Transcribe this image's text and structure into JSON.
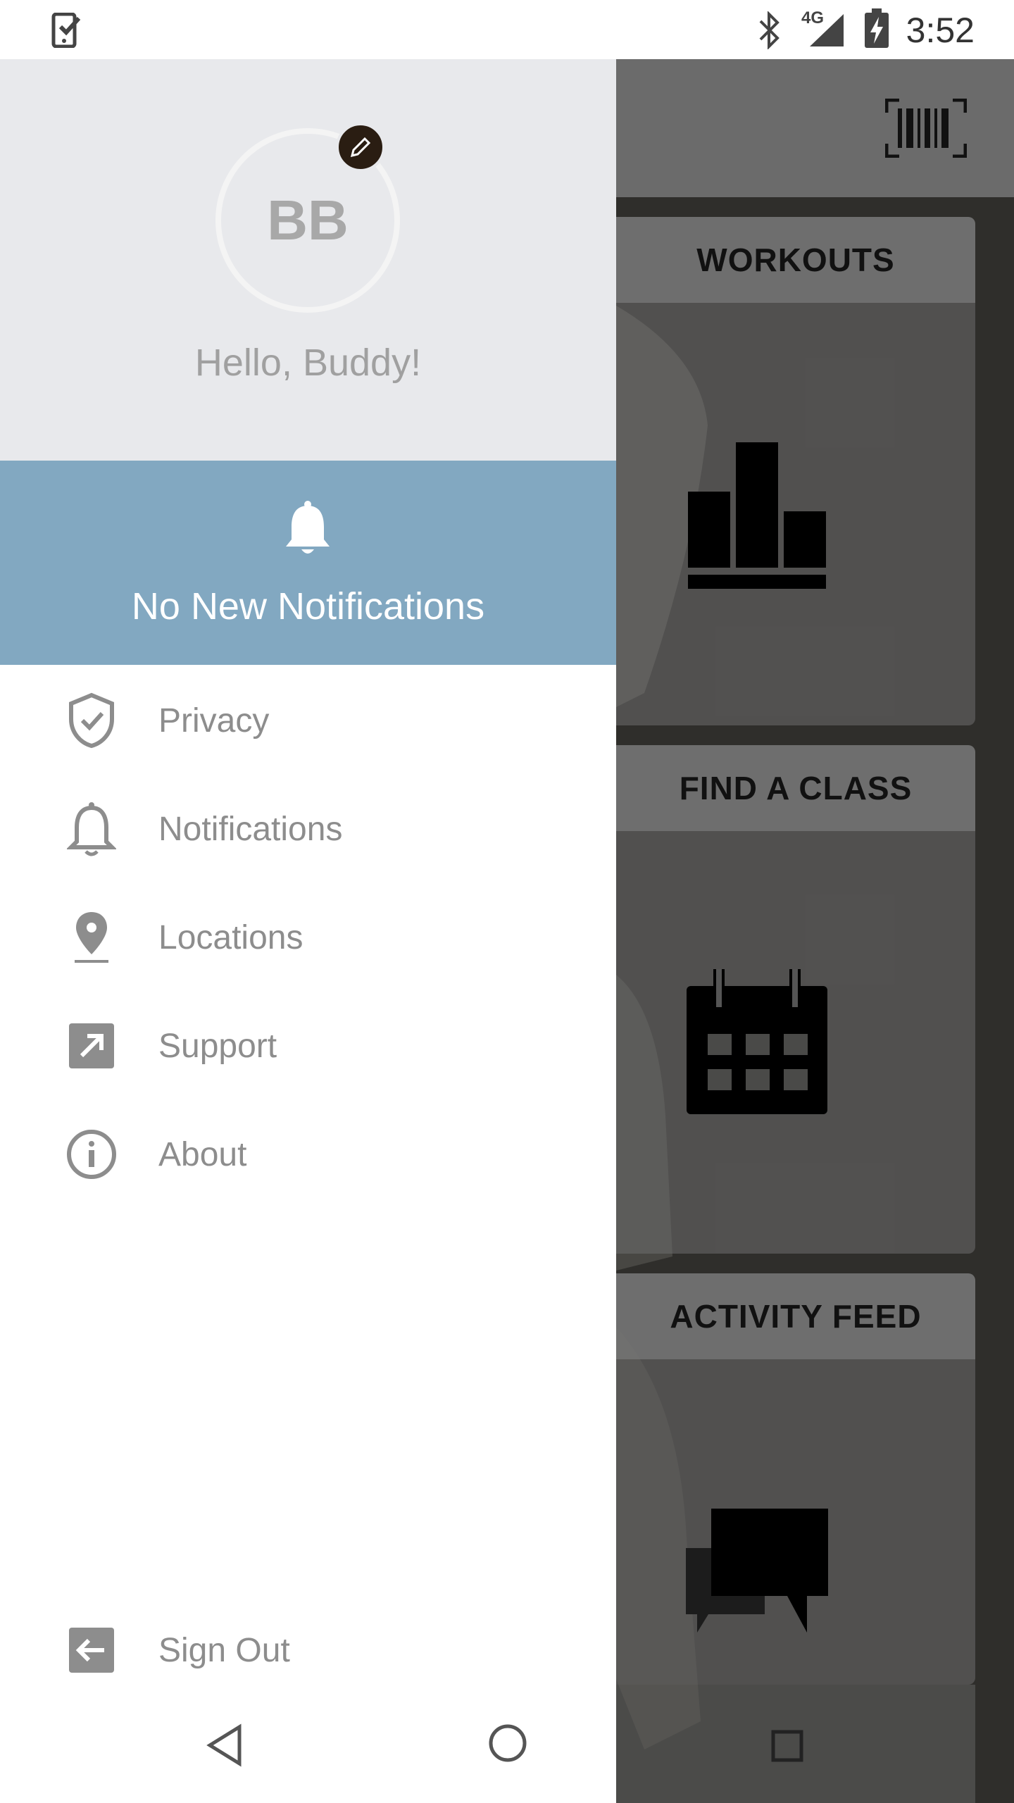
{
  "status_bar": {
    "time": "3:52",
    "network": "4G",
    "icons": [
      "task-checkbox-icon",
      "bluetooth-icon",
      "signal-icon",
      "battery-charging-icon"
    ]
  },
  "drawer": {
    "avatar_initials": "BB",
    "greeting": "Hello, Buddy!",
    "notifications_banner": "No New Notifications",
    "menu": [
      {
        "label": "Privacy",
        "icon": "shield-check-icon"
      },
      {
        "label": "Notifications",
        "icon": "bell-icon"
      },
      {
        "label": "Locations",
        "icon": "location-pin-icon"
      },
      {
        "label": "Support",
        "icon": "external-link-icon"
      },
      {
        "label": "About",
        "icon": "info-icon"
      }
    ],
    "sign_out": "Sign Out"
  },
  "background": {
    "tiles": [
      {
        "title": "WORKOUTS",
        "icon": "bar-chart-icon"
      },
      {
        "title": "FIND A CLASS",
        "icon": "calendar-icon"
      },
      {
        "title": "ACTIVITY FEED",
        "icon": "chat-bubbles-icon"
      }
    ],
    "toolbar_icon": "barcode-icon"
  },
  "colors": {
    "profile_bg": "#e8e9ec",
    "banner_bg": "#82a8c1",
    "menu_text": "#8d8d8d",
    "overlay_bg": "#2f2e2b"
  }
}
